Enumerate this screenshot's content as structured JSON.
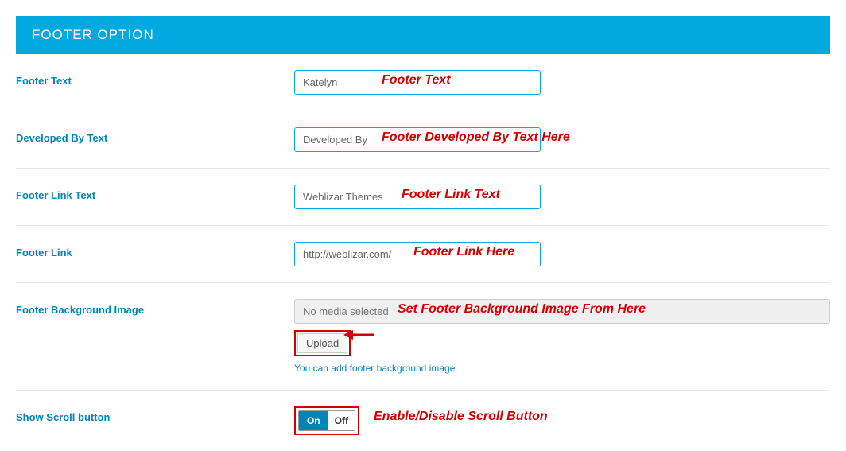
{
  "header": {
    "title": "FOOTER OPTION"
  },
  "rows": {
    "footer_text": {
      "label": "Footer Text",
      "value": "Katelyn",
      "annotation": "Footer Text"
    },
    "developed_by": {
      "label": "Developed By Text",
      "value": "Developed By",
      "annotation": "Footer Developed By Text Here"
    },
    "footer_link_text": {
      "label": "Footer Link Text",
      "value": "Weblizar Themes",
      "annotation": "Footer Link Text"
    },
    "footer_link": {
      "label": "Footer Link",
      "value": "http://weblizar.com/",
      "annotation": "Footer Link Here"
    },
    "bg_image": {
      "label": "Footer Background Image",
      "media_placeholder": "No media selected",
      "upload_label": "Upload",
      "help": "You can add footer background image",
      "annotation": "Set Footer Background Image From Here"
    },
    "scroll": {
      "label": "Show Scroll button",
      "on_label": "On",
      "off_label": "Off",
      "annotation": "Enable/Disable Scroll Button"
    }
  }
}
